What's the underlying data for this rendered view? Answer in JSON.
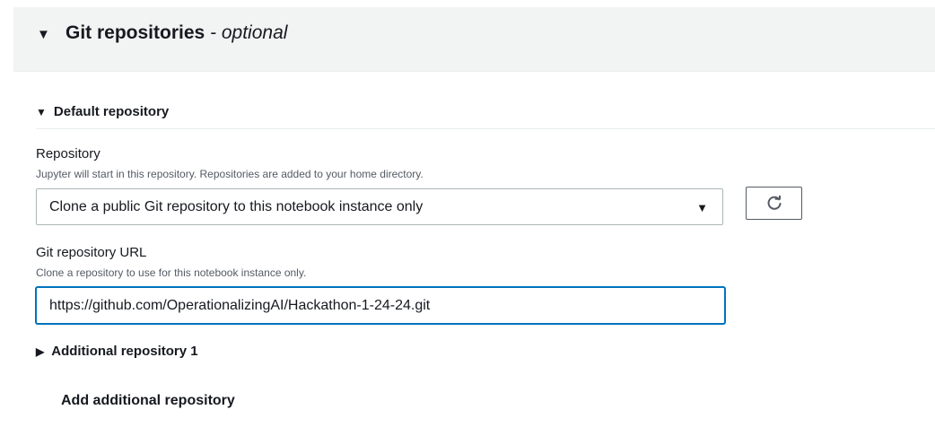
{
  "section": {
    "title": "Git repositories",
    "title_suffix": " - optional"
  },
  "default_repo": {
    "header": "Default repository",
    "repository_label": "Repository",
    "repository_hint": "Jupyter will start in this repository. Repositories are added to your home directory.",
    "repository_select_value": "Clone a public Git repository to this notebook instance only",
    "url_label": "Git repository URL",
    "url_hint": "Clone a repository to use for this notebook instance only.",
    "url_value": "https://github.com/OperationalizingAI/Hackathon-1-24-24.git"
  },
  "additional_repo": {
    "header": "Additional repository 1"
  },
  "add_repository_label": "Add additional repository",
  "icons": {
    "section_toggle": "caret-down-icon",
    "select_arrow": "caret-down-icon",
    "refresh": "refresh-icon"
  }
}
